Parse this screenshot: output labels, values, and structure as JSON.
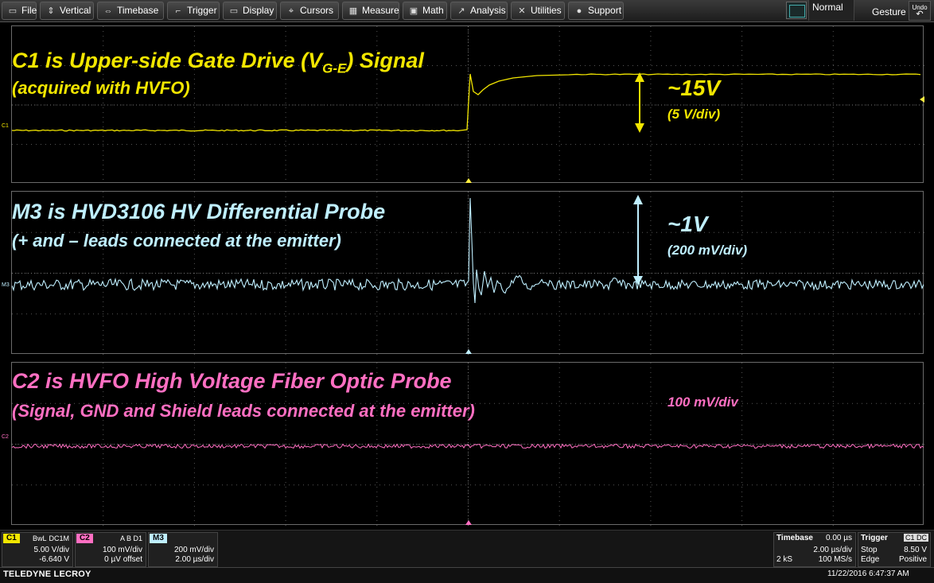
{
  "menu": {
    "items": [
      {
        "label": "File",
        "icon": "file-icon",
        "glyph": "▭"
      },
      {
        "label": "Vertical",
        "icon": "vertical-arrows-icon",
        "glyph": "⇕"
      },
      {
        "label": "Timebase",
        "icon": "horizontal-arrows-icon",
        "glyph": "⇔"
      },
      {
        "label": "Trigger",
        "icon": "trigger-icon",
        "glyph": "⌐"
      },
      {
        "label": "Display",
        "icon": "display-icon",
        "glyph": "▭"
      },
      {
        "label": "Cursors",
        "icon": "cursors-icon",
        "glyph": "⌖"
      },
      {
        "label": "Measure",
        "icon": "measure-icon",
        "glyph": "▦"
      },
      {
        "label": "Math",
        "icon": "math-icon",
        "glyph": "▣"
      },
      {
        "label": "Analysis",
        "icon": "analysis-icon",
        "glyph": "↗"
      },
      {
        "label": "Utilities",
        "icon": "utilities-icon",
        "glyph": "✕"
      },
      {
        "label": "Support",
        "icon": "support-icon",
        "glyph": "●"
      }
    ],
    "trigger_mode": "Normal",
    "gesture_label": "Gesture",
    "undo_label": "Undo"
  },
  "annotations": {
    "c1_title_prefix": "C1 is Upper-side Gate Drive (V",
    "c1_title_sub": "G-E",
    "c1_title_suffix": ") Signal",
    "c1_subtitle": "(acquired with HVFO)",
    "c1_amplitude": "~15V",
    "c1_scale": "(5 V/div)",
    "m3_title": "M3 is HVD3106 HV Differential Probe",
    "m3_subtitle": "(+ and – leads connected at the emitter)",
    "m3_amplitude": "~1V",
    "m3_scale": "(200 mV/div)",
    "c2_title": "C2 is HVFO High Voltage Fiber Optic Probe",
    "c2_subtitle": "(Signal, GND and Shield leads connected at the emitter)",
    "c2_scale": "100 mV/div"
  },
  "trace_markers": {
    "c1": "C1",
    "m3": "M3",
    "c2": "C2"
  },
  "colors": {
    "c1": "#f2e600",
    "m3": "#bfefff",
    "c2": "#ff6fc2",
    "trigger": "#ffef40",
    "brand": "#ffffff"
  },
  "channels": [
    {
      "tag": "C1",
      "line1_left": "BwL",
      "line1_right": "DC1M",
      "line2": "5.00 V/div",
      "line3": "-6.640 V"
    },
    {
      "tag": "C2",
      "line1_left": "",
      "line1_right": "A B D1",
      "line2": "100 mV/div",
      "line3": "0 µV offset"
    },
    {
      "tag": "M3",
      "line1_left": "",
      "line1_right": "",
      "line2": "200 mV/div",
      "line3": "2.00 µs/div"
    }
  ],
  "timebase": {
    "label": "Timebase",
    "delay": "0.00 µs",
    "per_div": "2.00 µs/div",
    "points": "2 kS",
    "rate": "100 MS/s"
  },
  "trigger": {
    "label": "Trigger",
    "source": "C1 DC",
    "mode": "Stop",
    "level": "8.50 V",
    "type": "Edge",
    "slope": "Positive"
  },
  "footer": {
    "brand": "TELEDYNE LECROY",
    "timestamp": "11/22/2016 6:47:37 AM"
  }
}
